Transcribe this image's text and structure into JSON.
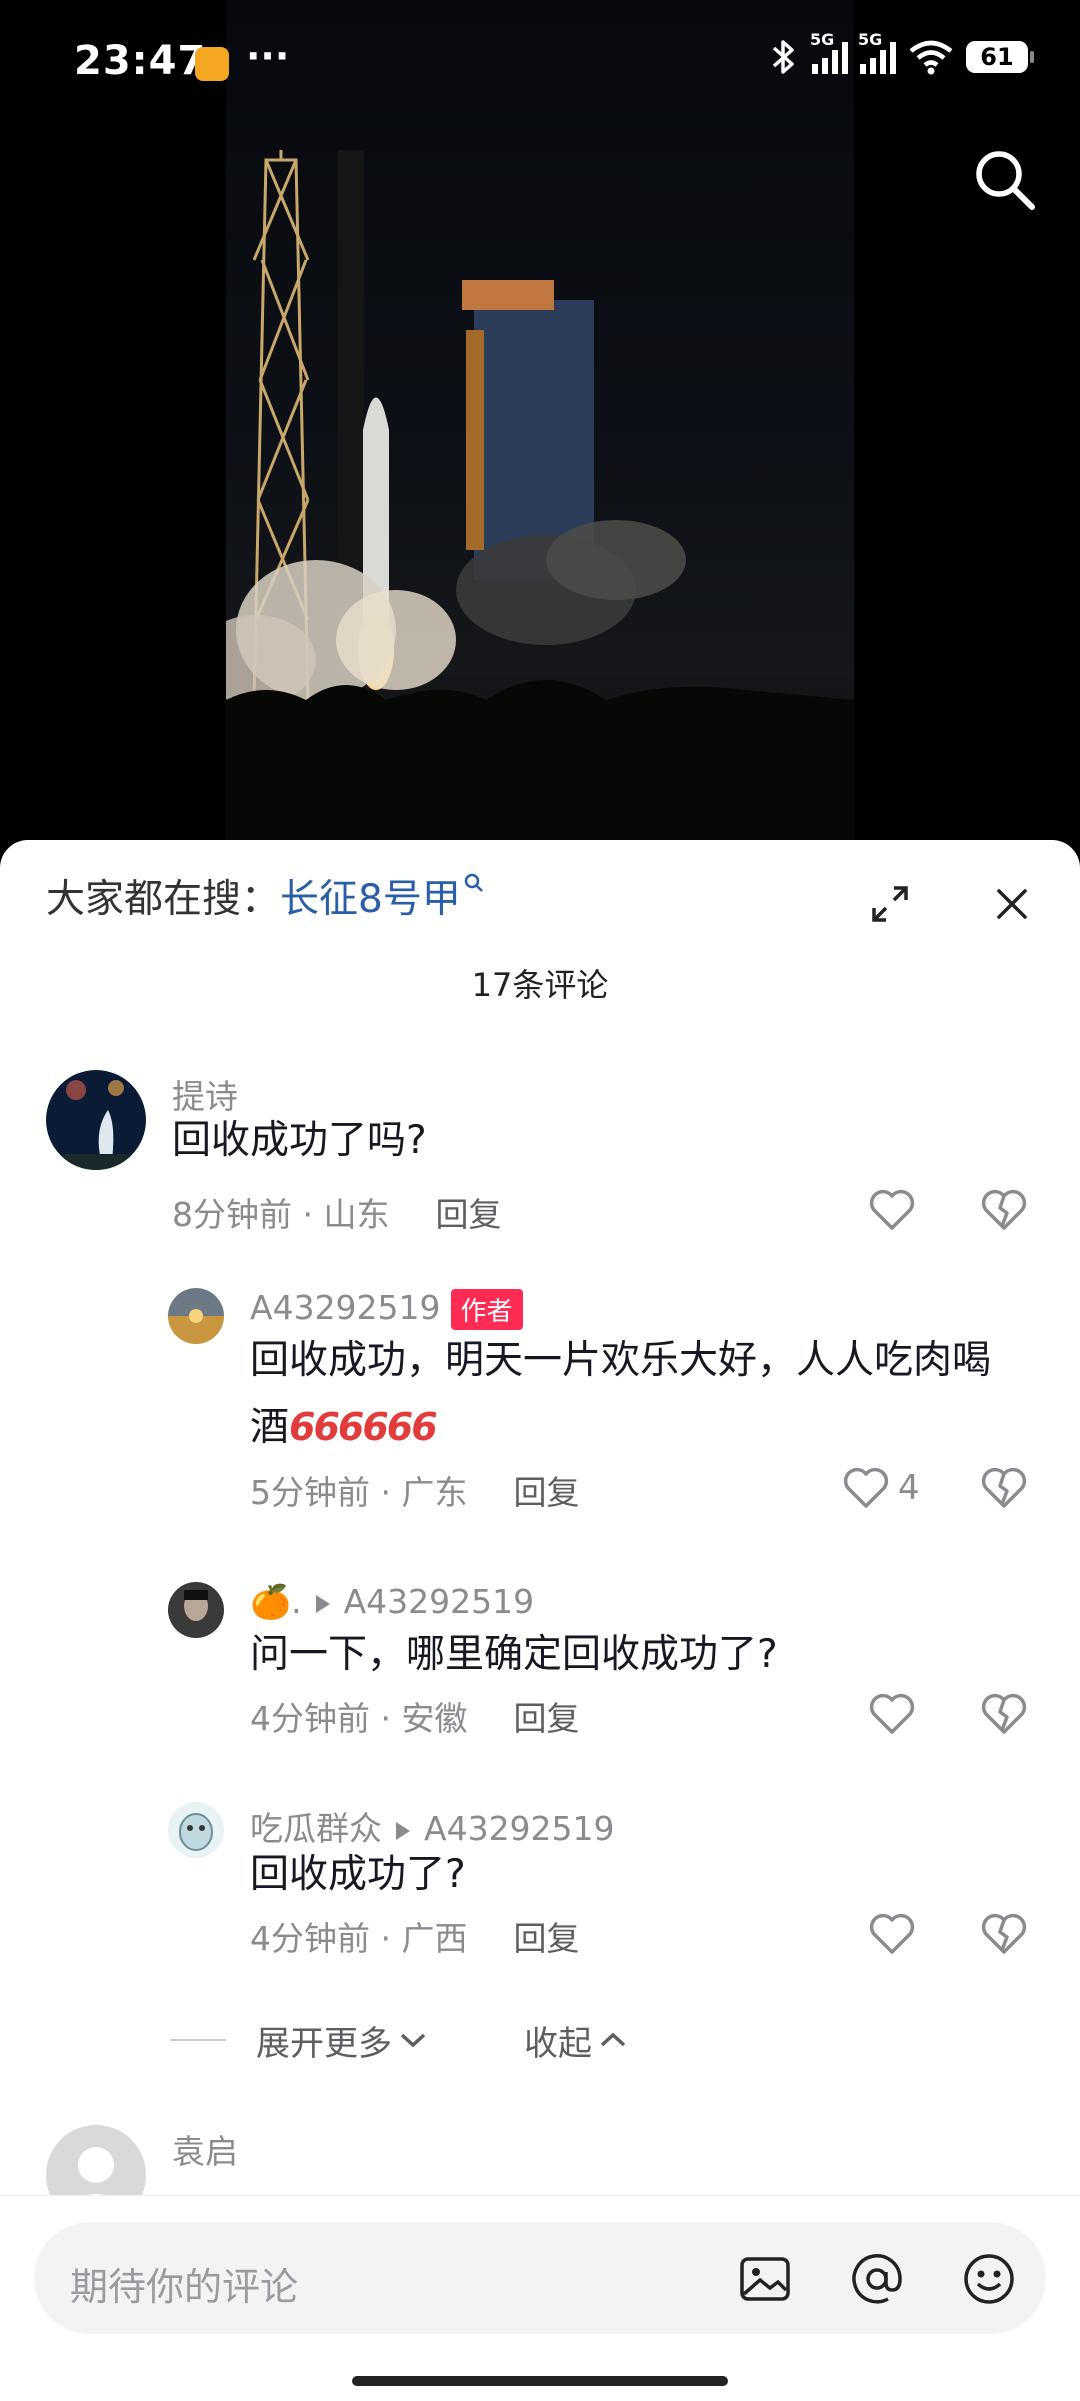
{
  "status_bar": {
    "time": "23:47",
    "dots": "···",
    "battery": "61"
  },
  "panel": {
    "hot_search_label": "大家都在搜：",
    "hot_search_keyword": "长征8号甲",
    "comment_count": "17条评论"
  },
  "comments": [
    {
      "name": "提诗",
      "text": "回收成功了吗?",
      "time": "8分钟前",
      "location": "山东",
      "reply": "回复",
      "likes": ""
    },
    {
      "name": "A43292519",
      "badge": "作者",
      "text": "回收成功，明天一片欢乐大好，人人吃肉喝酒",
      "emoji": "666666",
      "time": "5分钟前",
      "location": "广东",
      "reply": "回复",
      "likes": "4"
    },
    {
      "name": "🍊.",
      "reply_to": "A43292519",
      "text": "问一下，哪里确定回收成功了?",
      "time": "4分钟前",
      "location": "安徽",
      "reply": "回复",
      "likes": ""
    },
    {
      "name": "吃瓜群众",
      "reply_to": "A43292519",
      "text": "回收成功了?",
      "time": "4分钟前",
      "location": "广西",
      "reply": "回复",
      "likes": ""
    },
    {
      "name": "袁启"
    }
  ],
  "thread_controls": {
    "expand_more": "展开更多",
    "collapse": "收起"
  },
  "input_bar": {
    "placeholder": "期待你的评论"
  },
  "icons": [
    "search-icon",
    "expand-icon",
    "close-icon",
    "heart-icon",
    "broken-heart-icon",
    "chevron-down-icon",
    "chevron-up-icon",
    "image-icon",
    "at-icon",
    "emoji-icon"
  ],
  "colors": {
    "author_badge": "#fe2c55",
    "keyword": "#2a5ea6",
    "meta": "#8a8b91"
  }
}
